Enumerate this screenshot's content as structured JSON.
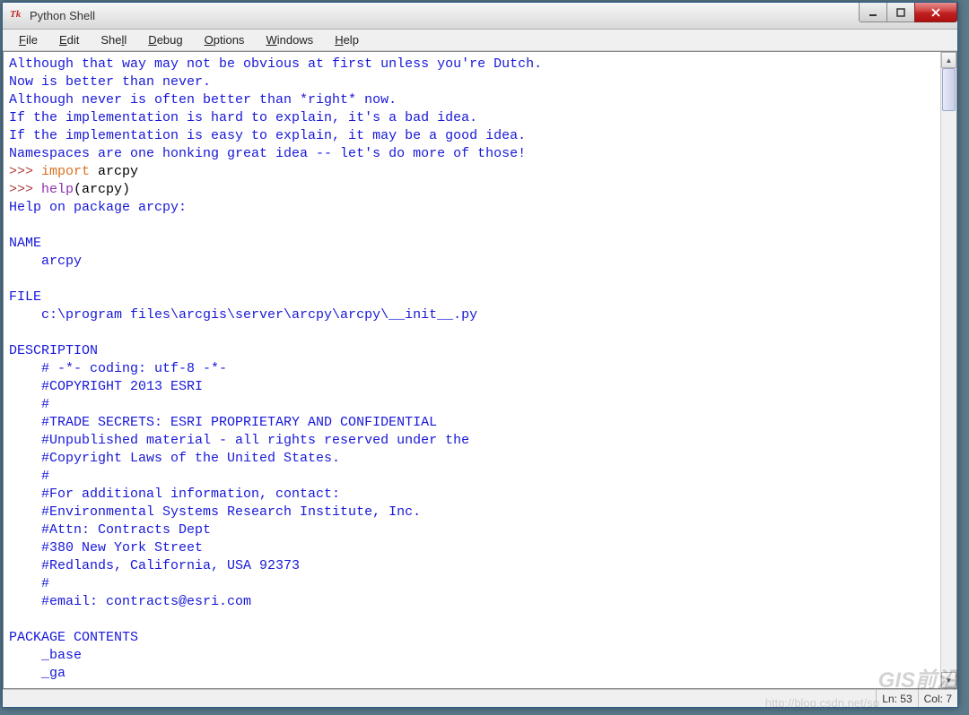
{
  "window": {
    "title": "Python Shell",
    "icon_label": "Tk"
  },
  "menubar": {
    "items": [
      {
        "key": "F",
        "rest": "ile"
      },
      {
        "key": "E",
        "rest": "dit"
      },
      {
        "key": "",
        "rest": "She",
        "key2": "l",
        "rest2": "l"
      },
      {
        "key": "D",
        "rest": "ebug"
      },
      {
        "key": "O",
        "rest": "ptions"
      },
      {
        "key": "W",
        "rest": "indows"
      },
      {
        "key": "H",
        "rest": "elp"
      }
    ]
  },
  "console": {
    "zen_lines": [
      "Although that way may not be obvious at first unless you're Dutch.",
      "Now is better than never.",
      "Although never is often better than *right* now.",
      "If the implementation is hard to explain, it's a bad idea.",
      "If the implementation is easy to explain, it may be a good idea.",
      "Namespaces are one honking great idea -- let's do more of those!"
    ],
    "prompt": ">>> ",
    "import_kw": "import",
    "import_mod": " arcpy",
    "help_kw": "help",
    "help_arg": "(arcpy)",
    "help_lines": [
      "Help on package arcpy:",
      "",
      "NAME",
      "    arcpy",
      "",
      "FILE",
      "    c:\\program files\\arcgis\\server\\arcpy\\arcpy\\__init__.py",
      "",
      "DESCRIPTION",
      "    # -*- coding: utf-8 -*-",
      "    #COPYRIGHT 2013 ESRI",
      "    #",
      "    #TRADE SECRETS: ESRI PROPRIETARY AND CONFIDENTIAL",
      "    #Unpublished material - all rights reserved under the",
      "    #Copyright Laws of the United States.",
      "    #",
      "    #For additional information, contact:",
      "    #Environmental Systems Research Institute, Inc.",
      "    #Attn: Contracts Dept",
      "    #380 New York Street",
      "    #Redlands, California, USA 92373",
      "    #",
      "    #email: contracts@esri.com",
      "",
      "PACKAGE CONTENTS",
      "    _base",
      "    _ga"
    ]
  },
  "status": {
    "ln": "Ln: 53",
    "col": "Col: 7"
  },
  "watermark": {
    "main": "GIS前沿",
    "url": "http://blog.csdn.net/sp"
  }
}
